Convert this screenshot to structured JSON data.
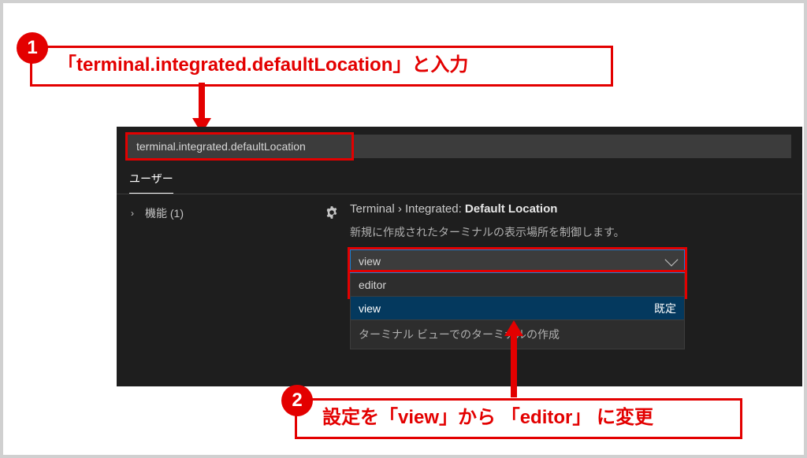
{
  "callout1": "「terminal.integrated.defaultLocation」と入力",
  "callout2": "設定を「view」から 「editor」 に変更",
  "badge1": "1",
  "badge2": "2",
  "search_value": "terminal.integrated.defaultLocation",
  "tabs": {
    "user": "ユーザー"
  },
  "tree": {
    "features_label": "機能 (1)"
  },
  "setting": {
    "crumb": "Terminal › Integrated:",
    "name": "Default Location",
    "desc": "新規に作成されたターミナルの表示場所を制御します。",
    "value": "view",
    "options": {
      "editor": "editor",
      "view": "view",
      "default_badge": "既定"
    },
    "hint": "ターミナル ビューでのターミナルの作成"
  }
}
